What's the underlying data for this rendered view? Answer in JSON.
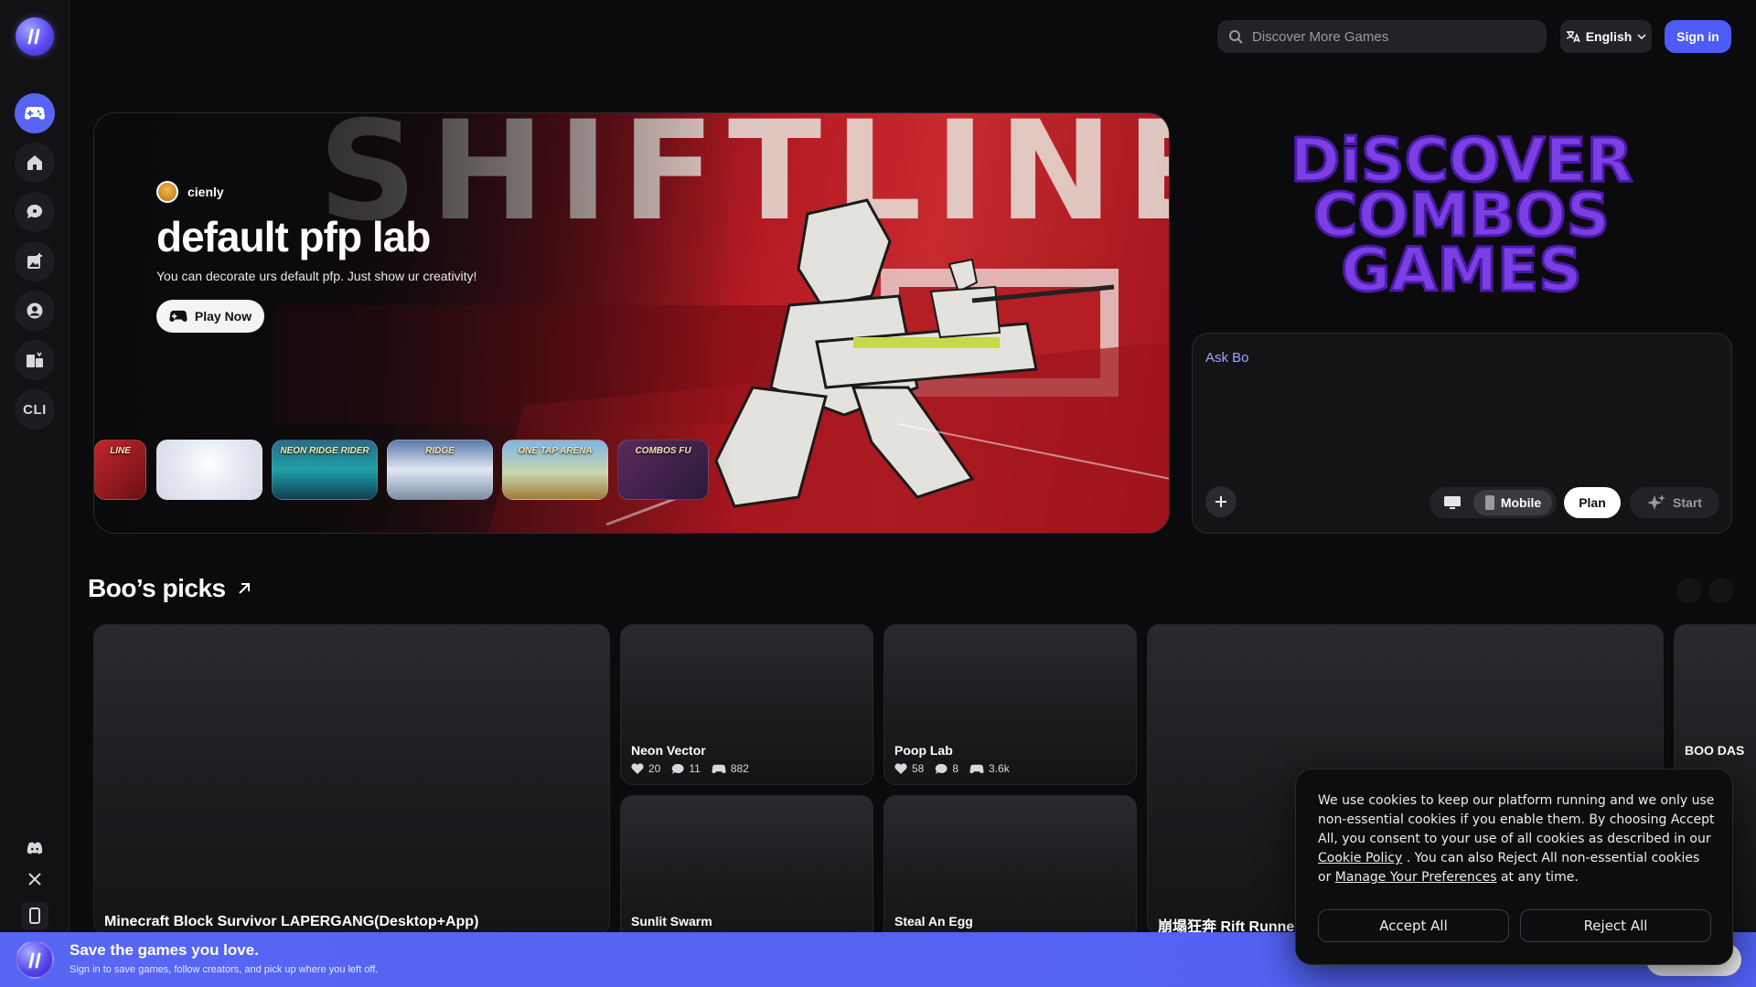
{
  "topbar": {
    "search_placeholder": "Discover More Games",
    "language": "English",
    "sign_in": "Sign in"
  },
  "sidebar": {
    "items": [
      {
        "icon": "gamepad-icon",
        "active": true
      },
      {
        "icon": "home-icon"
      },
      {
        "icon": "chat-bubble-icon"
      },
      {
        "icon": "image-add-icon"
      },
      {
        "icon": "user-icon"
      },
      {
        "icon": "gift-icon"
      },
      {
        "label": "CLI"
      }
    ],
    "bottom": [
      "discord-icon",
      "x-icon",
      "mobile-icon"
    ]
  },
  "hero": {
    "creator": "cienly",
    "title": "default pfp lab",
    "description": "You can decorate urs default pfp. Just show ur creativity!",
    "play_label": "Play Now",
    "art_text": "SHIFTLINE",
    "thumbnails": [
      "LINE",
      "",
      "NEON RIDGE RIDER",
      "RIDGE",
      "ONE TAP ARENA",
      "COMBOS FU"
    ]
  },
  "discover": {
    "lines": [
      "DiSCOVER",
      "COMBOS",
      "GAMES"
    ]
  },
  "ask": {
    "label": "Ask Bo",
    "mobile_label": "Mobile",
    "plan_label": "Plan",
    "start_label": "Start"
  },
  "picks": {
    "title": "Boo’s picks",
    "cards": [
      {
        "title": "Minecraft Block Survivor LAPERGANG(Desktop+App)"
      },
      {
        "title": "Neon Vector",
        "likes": "20",
        "comments": "11",
        "plays": "882"
      },
      {
        "title": "Poop Lab",
        "likes": "58",
        "comments": "8",
        "plays": "3.6k"
      },
      {
        "title": "Sunlit Swarm"
      },
      {
        "title": "Steal An Egg"
      },
      {
        "title": "崩塌狂奔 Rift Runner"
      },
      {
        "title": "BOO DAS"
      }
    ]
  },
  "banner": {
    "title": "Save the games you love.",
    "subtitle": "Sign in to save games, follow creators, and pick up where you left off."
  },
  "cookie": {
    "text_1": "We use cookies to keep our platform running and we only use non-essential cookies if you enable them. By choosing Accept All, you consent to your use of all cookies as described in our ",
    "link_policy": "Cookie Policy",
    "text_2": " . You can also Reject All non-essential cookies or ",
    "link_prefs": "Manage Your Preferences",
    "text_3": " at any time.",
    "accept": "Accept All",
    "reject": "Reject All"
  },
  "colors": {
    "accent": "#4d5cf5",
    "banner": "#5866f4",
    "hero_red": "#c62a2f",
    "discover_purple": "#7b3fe4"
  }
}
